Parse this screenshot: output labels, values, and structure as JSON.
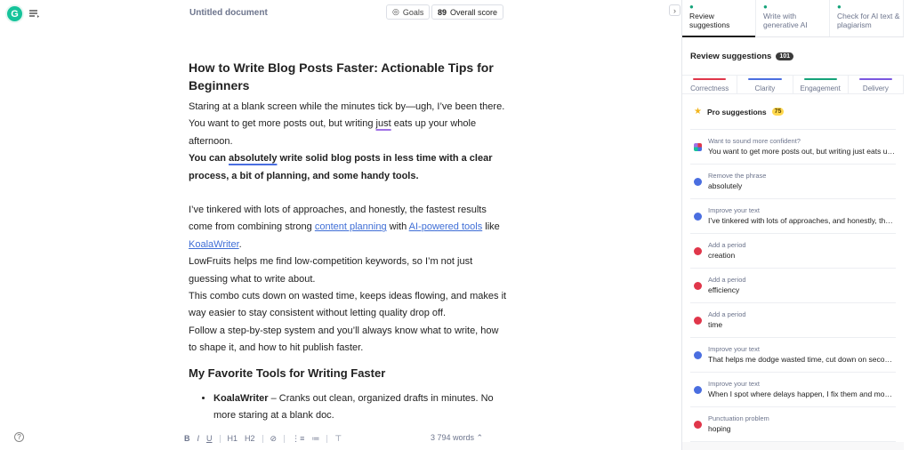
{
  "app": {
    "logo_letter": "G",
    "doc_title": "Untitled document",
    "goals_label": "Goals",
    "score_value": "89",
    "score_label": "Overall score",
    "word_count": "3 794 words",
    "help_glyph": "?"
  },
  "document": {
    "title": "How to Write Blog Posts Faster: Actionable Tips for Beginners",
    "p1_a": "Staring at a blank screen while the minutes tick by—ugh, I’ve been there. You want to get more posts out, but writing ",
    "p1_just": "just",
    "p1_b": " eats up your whole afternoon.",
    "p2_a": "You can ",
    "p2_absolutely": "absolutely",
    "p2_b": " write solid blog posts in less time with a clear process, a bit of planning, and some handy tools.",
    "p3_a": "I’ve tinkered with lots of approaches, and honestly, the fastest results come from combining strong ",
    "p3_link1": "content planning",
    "p3_b": " with ",
    "p3_link2": "AI-powered tools",
    "p3_c": " like ",
    "p3_link3": "KoalaWriter",
    "p3_d": ".",
    "p4": "LowFruits helps me find low-competition keywords, so I’m not just guessing what to write about.",
    "p5": "This combo cuts down on wasted time, keeps ideas flowing, and makes it way easier to stay consistent without letting quality drop off.",
    "p6": "Follow a step-by-step system and you’ll always know what to write, how to shape it, and how to hit publish faster.",
    "h2": "My Favorite Tools for Writing Faster",
    "li1_bold": "KoalaWriter",
    "li1_rest": " – Cranks out clean, organized drafts in minutes. No more staring at a blank doc."
  },
  "toolbar": {
    "bold": "B",
    "italic": "I",
    "underline": "U",
    "h1": "H1",
    "h2": "H2",
    "link": "⊘",
    "ol": "⋮≡",
    "ul": "≔",
    "clear": "⊤"
  },
  "panel": {
    "collapse_glyph": "›",
    "tabs": [
      {
        "label": "Review suggestions",
        "icon": "G"
      },
      {
        "label": "Write with generative AI",
        "icon": "✎"
      },
      {
        "label": "Check for AI text & plagiarism",
        "icon": "»"
      }
    ],
    "header": "Review suggestions",
    "count": "101",
    "categories": [
      {
        "label": "Correctness",
        "color": "#e0364a"
      },
      {
        "label": "Clarity",
        "color": "#4a6ee0"
      },
      {
        "label": "Engagement",
        "color": "#15a37a"
      },
      {
        "label": "Delivery",
        "color": "#7b57e0"
      }
    ],
    "pro_label": "Pro suggestions",
    "pro_count": "75",
    "suggestions": [
      {
        "label": "Want to sound more confident?",
        "value": "You want to get more posts out, but writing just eats up your whole afternoon.",
        "icon": "multi"
      },
      {
        "label": "Remove the phrase",
        "value": "absolutely",
        "icon": "blue"
      },
      {
        "label": "Improve your text",
        "value": "I’ve tinkered with lots of approaches, and honestly, the fastest results",
        "icon": "blue"
      },
      {
        "label": "Add a period",
        "value": "creation",
        "icon": "red"
      },
      {
        "label": "Add a period",
        "value": "efficiency",
        "icon": "red"
      },
      {
        "label": "Add a period",
        "value": "time",
        "icon": "red"
      },
      {
        "label": "Improve your text",
        "value": "That helps me dodge wasted time, cut down on second-guessing",
        "icon": "blue"
      },
      {
        "label": "Improve your text",
        "value": "When I spot where delays happen, I fix them and move faster",
        "icon": "blue"
      },
      {
        "label": "Punctuation problem",
        "value": "hoping",
        "icon": "red"
      }
    ]
  }
}
